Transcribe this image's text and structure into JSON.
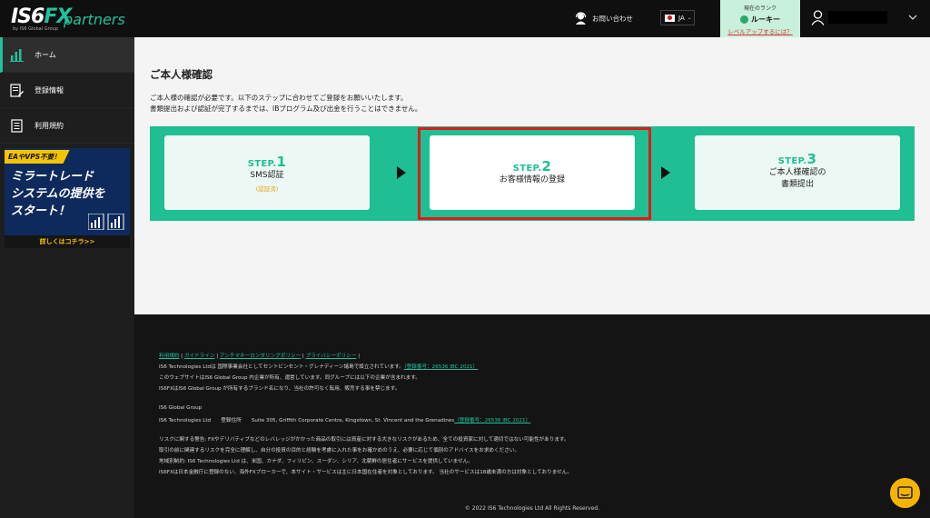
{
  "header": {
    "logo_main": "IS6",
    "logo_fx": "FX",
    "logo_partners": "partners",
    "logo_sub": "by IS6 Global Group",
    "contact_label": "お問い合わせ",
    "lang": "JA",
    "rank_label": "現在のランク",
    "rank_name": "ルーキー",
    "rank_link": "レベルアップするには？"
  },
  "sidebar": {
    "items": [
      {
        "label": "ホーム"
      },
      {
        "label": "登録情報"
      },
      {
        "label": "利用規約"
      }
    ],
    "banner": {
      "tag": "EAやVPS不要！",
      "text": "ミラートレード\nシステムの提供を\nスタート！",
      "cta": "詳しくはコチラ>>"
    }
  },
  "main": {
    "title": "ご本人様確認",
    "desc_line1": "ご本人様の確認が必要です。以下のステップに合わせてご登録をお願いいたします。",
    "desc_line2": "書類提出および認証が完了するまでは、IBプログラム及び出金を行うことはできません。",
    "steps": [
      {
        "label": "STEP.",
        "num": "1",
        "title": "SMS認証",
        "sub": "(認証済)"
      },
      {
        "label": "STEP.",
        "num": "2",
        "title": "お客様情報の登録"
      },
      {
        "label": "STEP.",
        "num": "3",
        "title_line1": "ご本人様確認の",
        "title_line2": "書類提出"
      }
    ]
  },
  "footer": {
    "links": [
      "利用規約",
      "ガイドライン",
      "アンチマネーロンダリングポリシー",
      "プライバシーポリシー"
    ],
    "l1": "IS6 Technologies Ltdは 国際事業会社としてセントビンセント・グレナディーン諸島で設立されています。",
    "l1_reg": "（登録番号：26536 IBC 2021）",
    "l2": "このウェブサイトはIS6 Global Group 内企業が所有、運営しています。同グループには以下の企業が含まれます。",
    "l3": "IS6FXはIS6 Global Group が所有するブランド名になり、当社の許可なく転用、販売する事を禁じます。",
    "l4": "IS6 Global Group",
    "l5": "IS6 Technologies Ltd　　登録住所　　Suite 305, Griffith Corporate Centre, Kingstown, St. Vincent and the Grenadines",
    "l5_reg": "（登録番号：26536 IBC 2021）",
    "l6": "リスクに関する警告: FXやデリバティブなどのレバレッジがかかった商品の取引には資産に対する大きなリスクがあるため、全ての投資家に対して適切ではない可能性があります。",
    "l7": "取引の前に関連するリスクを完全に理解し、自分の投資の目的と経験を考慮に入れた事をお確かめのうえ、必要に応じて個別のアドバイスをお求めください。",
    "l8": "地域別制約: IS6 Technologies Ltd は、米国、カナダ、フィリピン、スーダン、シリア、北朝鮮の居住者にサービスを提供していません。",
    "l9": "IS6FXは日本金融庁に登録のない、海外FXブローカーで、本サイト・サービスは主に日本国在住者を対象としております。 当社のサービスは18歳未満の方は対象としておりません。",
    "copyright": "© 2022 IS6 Technologies Ltd All Rights Reserved."
  },
  "colors": {
    "accent": "#1fbf93",
    "highlight": "#e01a1a",
    "warning": "#e6a200"
  }
}
